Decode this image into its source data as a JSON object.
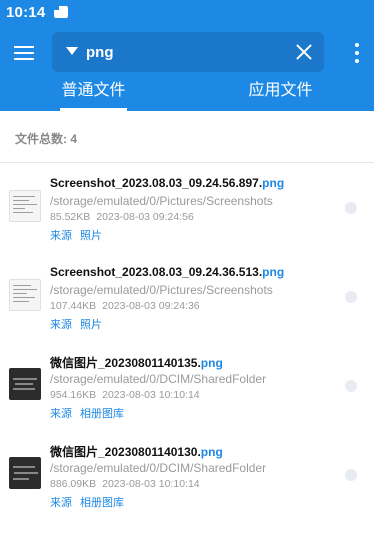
{
  "status_bar": {
    "time": "10:14",
    "icon": "sim-card-icon"
  },
  "search": {
    "query": "png"
  },
  "tabs": [
    {
      "label": "普通文件",
      "active": true
    },
    {
      "label": "应用文件",
      "active": false
    }
  ],
  "summary": {
    "label": "文件总数:",
    "count": "4"
  },
  "colors": {
    "accent": "#1e88e5",
    "extension": "#1e88e5",
    "secondary_text": "#9a9a9a"
  },
  "files": [
    {
      "name": "Screenshot_2023.08.03_09.24.56.897.",
      "ext": "png",
      "path": "/storage/emulated/0/Pictures/Screenshots",
      "size": "85.52KB",
      "date": "2023-08-03 09:24:56",
      "source_label": "来源",
      "source": "照片",
      "thumbnail": "light"
    },
    {
      "name": "Screenshot_2023.08.03_09.24.36.513.",
      "ext": "png",
      "path": "/storage/emulated/0/Pictures/Screenshots",
      "size": "107.44KB",
      "date": "2023-08-03 09:24:36",
      "source_label": "来源",
      "source": "照片",
      "thumbnail": "light"
    },
    {
      "name": "微信图片_20230801140135.",
      "ext": "png",
      "path": "/storage/emulated/0/DCIM/SharedFolder",
      "size": "954.16KB",
      "date": "2023-08-03 10:10:14",
      "source_label": "来源",
      "source": "相册图库",
      "thumbnail": "dark"
    },
    {
      "name": "微信图片_20230801140130.",
      "ext": "png",
      "path": "/storage/emulated/0/DCIM/SharedFolder",
      "size": "886.09KB",
      "date": "2023-08-03 10:10:14",
      "source_label": "来源",
      "source": "相册图库",
      "thumbnail": "dark"
    }
  ]
}
